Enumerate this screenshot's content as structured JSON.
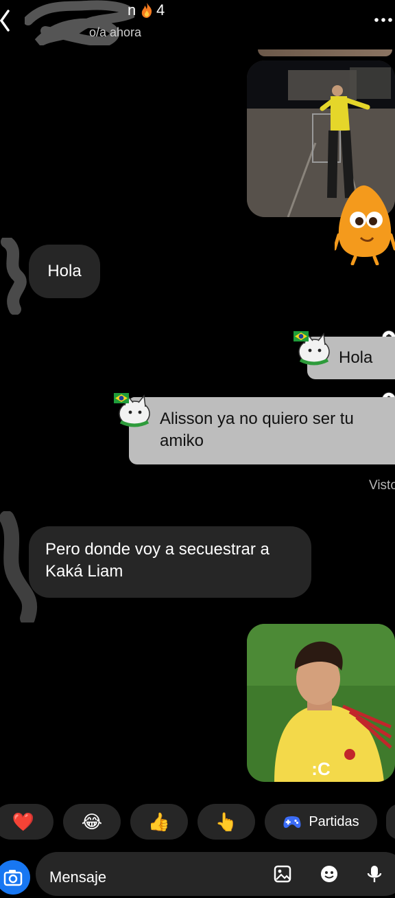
{
  "header": {
    "title_suffix": "n",
    "streak_count": "4",
    "status": "o/a ahora",
    "more_label": "···"
  },
  "messages": {
    "hola_in": "Hola",
    "hola_out": "Hola",
    "alisson": "Alisson ya no quiero ser tu amiko",
    "visto": "Visto",
    "pero": "Pero donde voy a secuestrar a Kaká Liam"
  },
  "media2_caption": ":C",
  "quick_replies": {
    "heart": "❤️",
    "joy": "😂",
    "thumb": "👍",
    "point": "👆",
    "games_label": "Partidas"
  },
  "composer": {
    "placeholder": "Mensaje"
  },
  "colors": {
    "accent": "#1877f2",
    "incoming_bubble": "#262626",
    "outgoing_bubble": "#bdbdbd",
    "background": "#000000"
  },
  "icons": [
    "back-chevron-icon",
    "fire-icon",
    "more-icon",
    "camera-icon",
    "gallery-icon",
    "sticker-icon",
    "mic-icon",
    "gamepad-icon",
    "soccer-ball-icon"
  ]
}
